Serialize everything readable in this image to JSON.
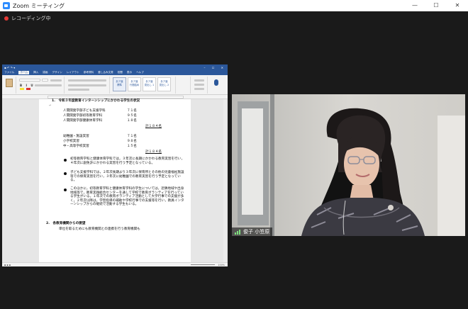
{
  "window": {
    "title": "Zoom ミーティング",
    "controls": [
      "—",
      "☐",
      "✕"
    ]
  },
  "recording": {
    "label": "レコーディング中"
  },
  "word": {
    "title": "",
    "user": "",
    "tabs": [
      "ファイル",
      "ホーム",
      "挿入",
      "描画",
      "デザイン",
      "レイアウト",
      "参考資料",
      "差し込み文書",
      "校閲",
      "表示",
      "ヘルプ"
    ],
    "styles": [
      "あア亜\n標準",
      "あア亜\n行間詰め",
      "あア亜\n見出し 1",
      "あア亜\n見出し 2"
    ],
    "status_zoom": "100%"
  },
  "document": {
    "heading1": "1.　令和３年度教育インターンシップにかかわる学生の状況",
    "rows_a": [
      {
        "label": "人間関発学部子ども支援学科",
        "value": "７１名"
      },
      {
        "label": "人間関発学部初等教育学科",
        "value": "９５名"
      },
      {
        "label": "人間関発学部健康体育学科",
        "value": "１８名"
      }
    ],
    "total_a": "計１８４名",
    "rows_b": [
      {
        "label": "幼稚園・施設実習",
        "value": "７１名"
      },
      {
        "label": "小学校実習",
        "value": "９８名"
      },
      {
        "label": "中・高等学校実習",
        "value": "１５名"
      }
    ],
    "total_b": "計１８４名",
    "bullets": [
      "初等教育学科と健康体育学科では，３年次に長期にかかわる教育実習を行い，４年次に副免許にかかわる実習を行う予定となっている。",
      "子ども支援学科では，２年次後期より３年次に保育所とその他の児童福祉施設等での保育実習を行い，３年次に幼稚園での教育実習を行う予定となっている。",
      "このほかに，初等教育学科と健康体育学科の学生については，近隣地域や出身地域等で，教育実践総合センターを通して学校で教育ボランティアを行っている学生がいる。１年次での教育ボランティア活動として大学行事での支援が多く，２年次以降は，学習指導の補助や学校行事での支援等を行い，教員インターンシップからの継続で活動する学生もいる。"
    ],
    "heading2": "2.　各教育機関からの要望",
    "line_end": "単位を取るためにも教育機関との連携を行う教育機関も"
  },
  "participant": {
    "name": "俊子 小笠原"
  }
}
